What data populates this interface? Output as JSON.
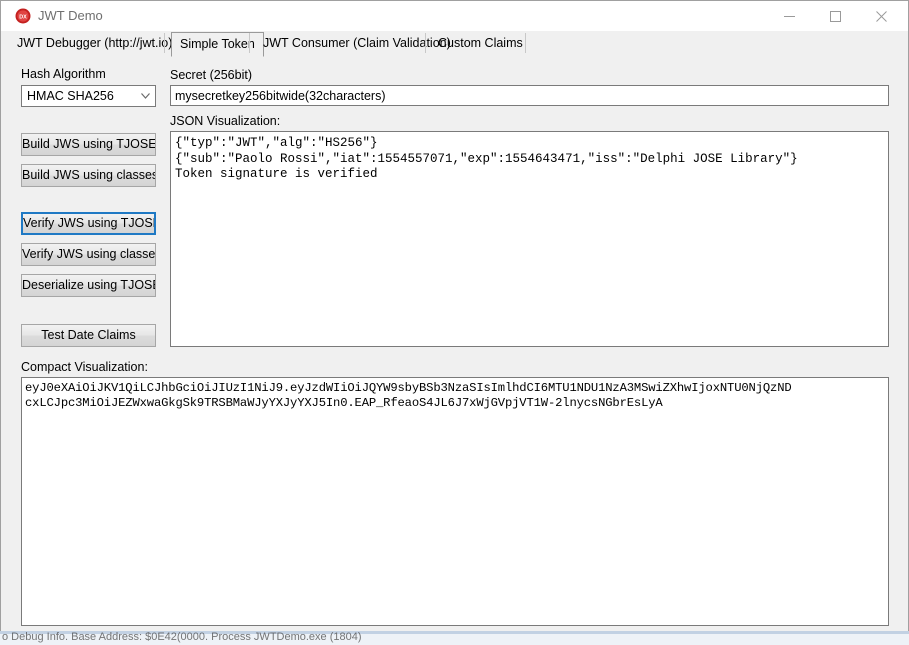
{
  "window": {
    "title": "JWT Demo",
    "icon": "delphi-app-icon",
    "controls": {
      "minimize": "minimize-icon",
      "maximize": "maximize-icon",
      "close": "close-icon"
    }
  },
  "tabs": [
    {
      "label": "JWT Debugger (http://jwt.io)",
      "selected": false
    },
    {
      "label": "Simple Token",
      "selected": true
    },
    {
      "label": "JWT Consumer (Claim Validation)",
      "selected": false
    },
    {
      "label": "Custom Claims",
      "selected": false
    }
  ],
  "left_panel": {
    "hash_algorithm_label": "Hash Algorithm",
    "hash_algorithm_value": "HMAC SHA256",
    "dropdown_icon": "chevron-down-icon",
    "buttons": [
      {
        "label": "Build JWS using TJOSE",
        "focused": false
      },
      {
        "label": "Build JWS using classes",
        "focused": false
      },
      {
        "label": "Verify JWS using TJOSE",
        "focused": true
      },
      {
        "label": "Verify JWS using classes",
        "focused": false
      },
      {
        "label": "Deserialize using TJOSE",
        "focused": false
      },
      {
        "label": "Test Date Claims",
        "focused": false
      }
    ]
  },
  "main": {
    "secret_label": "Secret (256bit)",
    "secret_value": "mysecretkey256bitwide(32characters)",
    "secret_placeholder": "",
    "json_label": "JSON Visualization:",
    "json_lines": [
      "{\"typ\":\"JWT\",\"alg\":\"HS256\"}",
      "{\"sub\":\"Paolo Rossi\",\"iat\":1554557071,\"exp\":1554643471,\"iss\":\"Delphi JOSE Library\"}",
      "Token signature is verified"
    ],
    "compact_label": "Compact Visualization:",
    "compact_lines": [
      "eyJ0eXAiOiJKV1QiLCJhbGciOiJIUzI1NiJ9.eyJzdWIiOiJQYW9sbyBSb3NzaSIsImlhdCI6MTU1NDU1NzA3MSwiZXhwIjoxNTU0NjQzND",
      "cxLCJpc3MiOiJEZWxwaGkgSk9TRSBMaWJyYXJyYXJ5In0.EAP_RfeaoS4JL6J7xWjGVpjVT1W-2lnycsNGbrEsLyA"
    ]
  },
  "status_bar": {
    "text": "o Debug Info. Base Address: $0E42(0000. Process JWTDemo.exe (1804)"
  },
  "colors": {
    "focus_border": "#1f79c4",
    "window_bg": "#f0f0f0",
    "field_bg": "#ffffff",
    "border": "#7a7a7a",
    "title_text": "#6f6f6f"
  }
}
